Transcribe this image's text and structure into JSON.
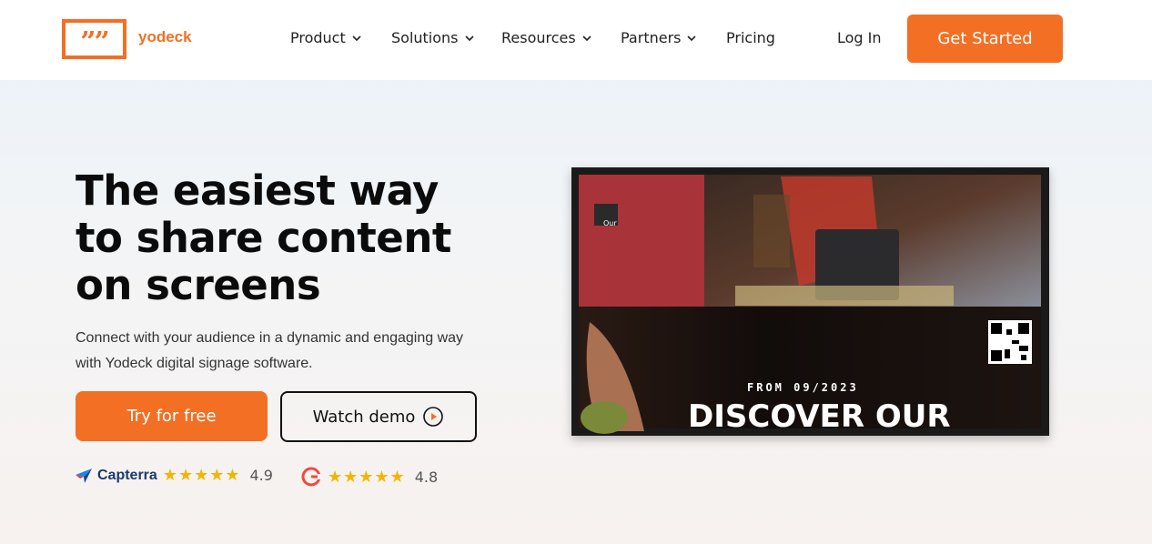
{
  "header": {
    "brand": "yodeck",
    "logo_glyph": "””",
    "nav": [
      {
        "label": "Product",
        "has_dropdown": true
      },
      {
        "label": "Solutions",
        "has_dropdown": true
      },
      {
        "label": "Resources",
        "has_dropdown": true
      },
      {
        "label": "Partners",
        "has_dropdown": true
      },
      {
        "label": "Pricing",
        "has_dropdown": false
      }
    ],
    "login_label": "Log In",
    "cta_label": "Get Started"
  },
  "hero": {
    "title_lines": [
      "The easiest way",
      "to share content",
      "on screens"
    ],
    "subtitle": "Connect with your audience in a dynamic and engaging way with Yodeck digital signage software.",
    "primary_button": "Try for free",
    "secondary_button": "Watch demo"
  },
  "ratings": [
    {
      "brand": "Capterra",
      "stars": "★★★★★",
      "score": "4.9",
      "icon": "capterra-icon"
    },
    {
      "brand": "G2",
      "stars": "★★★★★",
      "score": "4.8",
      "icon": "g2-icon"
    }
  ],
  "video": {
    "panel_logo": "Our",
    "overline": "FROM 09/2023",
    "headline": "DISCOVER OUR",
    "icon": "qr-code-icon"
  },
  "colors": {
    "accent": "#f36f24",
    "stars": "#f5b400",
    "panel_red": "#a83338"
  }
}
